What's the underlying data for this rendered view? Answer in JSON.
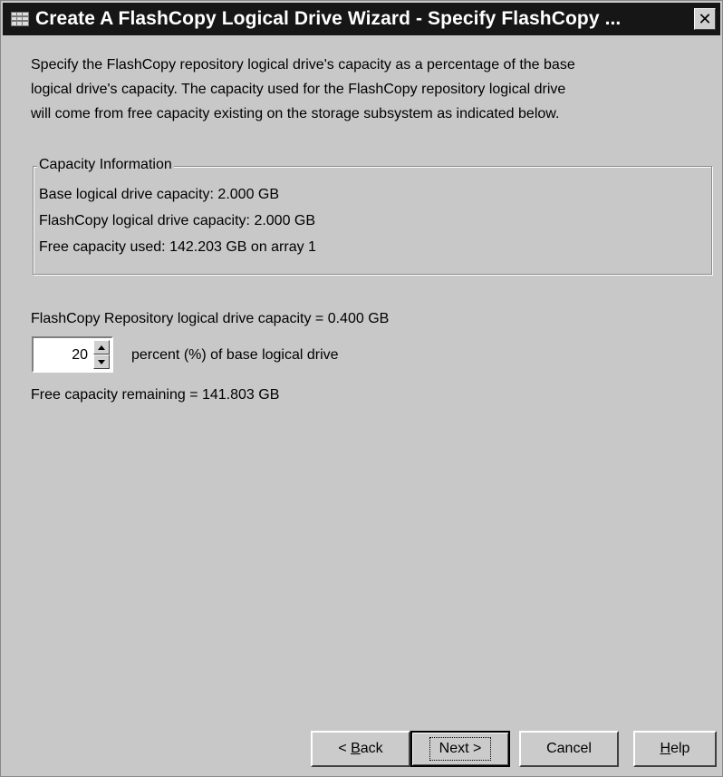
{
  "window": {
    "title": "Create A FlashCopy Logical Drive Wizard - Specify FlashCopy ...",
    "close_label": "✕"
  },
  "intro": {
    "line1": "Specify the FlashCopy repository logical drive's capacity as a percentage of the base",
    "line2": "logical drive's capacity. The capacity used for the FlashCopy repository logical drive",
    "line3": "will come from free capacity existing on the storage subsystem as indicated below."
  },
  "capacity_info": {
    "legend": "Capacity Information",
    "base": "Base logical drive capacity: 2.000 GB",
    "flashcopy": "FlashCopy logical drive capacity: 2.000 GB",
    "free_used": "Free capacity used: 142.203 GB on array 1"
  },
  "repository": {
    "capacity_text": "FlashCopy Repository logical drive capacity = 0.400 GB",
    "percent_value": "20",
    "percent_label": "percent (%) of base logical drive",
    "free_remaining": "Free capacity remaining = 141.803 GB"
  },
  "buttons": {
    "back_prefix": "< ",
    "back_mnemonic": "B",
    "back_rest": "ack",
    "next": "Next >",
    "cancel": "Cancel",
    "help_mnemonic": "H",
    "help_rest": "elp"
  },
  "icons": {
    "app": "wizard-app-icon",
    "close": "close-icon",
    "up": "arrow-up-icon",
    "down": "arrow-down-icon"
  }
}
